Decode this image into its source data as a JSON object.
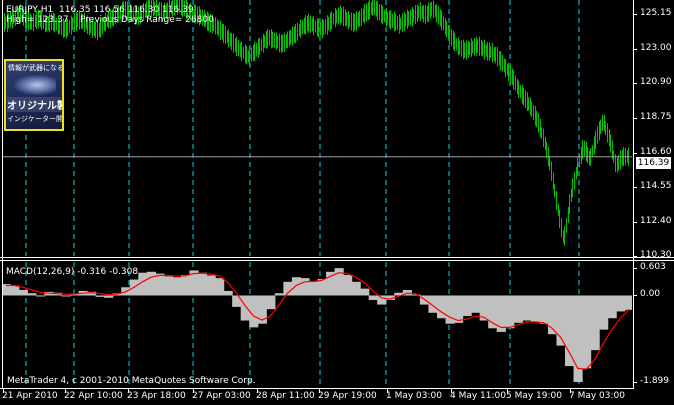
{
  "chart_header": {
    "symbol": "EURJPY,H1",
    "ohlc": "116.35 116.56 116.30 116.39",
    "info_line": "High= 123.37    Previous Days Range= 26800"
  },
  "logo": {
    "line1": "情報が武器になる",
    "line2": "オリジナル製作",
    "line3": "インジケーター開発"
  },
  "current_price": "116.39",
  "macd_header": "MACD(12,26,9) -0.316 -0.308",
  "copyright": "MetaTrader 4, c 2001-2010 MetaQuotes Software Corp.",
  "colors": {
    "background": "#000000",
    "candles": "#00c000",
    "histogram": "#c0c0c0",
    "signal_line": "#ff0000",
    "grid": "#00ffff"
  },
  "chart_data": [
    {
      "type": "line",
      "series": [
        {
          "name": "EURJPY,H1",
          "values": [
            124.6,
            124.9,
            125.2,
            124.8,
            124.6,
            124.9,
            124.5,
            124.7,
            124.4,
            124.2,
            124.5,
            124.8,
            124.6,
            124.3,
            124.1,
            124.6,
            124.9,
            125.1,
            125.4,
            125.2,
            125.0,
            125.3,
            125.6,
            125.4,
            125.2,
            125.5,
            125.7,
            125.5,
            125.3,
            125.1,
            124.9,
            124.6,
            124.4,
            124.0,
            123.6,
            123.2,
            122.8,
            122.5,
            122.9,
            123.3,
            123.7,
            123.5,
            123.3,
            123.6,
            123.9,
            124.3,
            124.6,
            124.4,
            124.2,
            124.5,
            124.9,
            125.1,
            124.8,
            124.6,
            124.9,
            125.3,
            125.6,
            125.2,
            124.9,
            124.7,
            124.5,
            124.8,
            125.0,
            125.3,
            125.1,
            125.5,
            125.0,
            124.3,
            123.6,
            123.1,
            122.9,
            123.1,
            123.2,
            122.9,
            122.8,
            122.5,
            121.9,
            121.4,
            120.6,
            120.0,
            119.4,
            118.6,
            117.4,
            115.8,
            113.4,
            111.2,
            113.8,
            115.6,
            117.0,
            116.2,
            117.6,
            118.6,
            117.4,
            115.8,
            116.4,
            116.39
          ]
        }
      ],
      "y_ticks": [
        "125.15",
        "123.00",
        "120.90",
        "118.75",
        "116.60",
        "114.55",
        "112.40",
        "110.30"
      ],
      "ylim": [
        110.3,
        126.0
      ]
    },
    {
      "type": "bar",
      "series": [
        {
          "name": "MACD",
          "values": [
            0.25,
            0.22,
            0.12,
            0.05,
            0.0,
            0.08,
            0.06,
            -0.02,
            0.04,
            0.1,
            0.08,
            -0.03,
            -0.05,
            0.05,
            0.18,
            0.35,
            0.5,
            0.52,
            0.48,
            0.42,
            0.4,
            0.45,
            0.55,
            0.5,
            0.44,
            0.38,
            0.1,
            -0.25,
            -0.55,
            -0.7,
            -0.62,
            -0.3,
            0.05,
            0.3,
            0.4,
            0.38,
            0.3,
            0.36,
            0.52,
            0.6,
            0.45,
            0.3,
            0.15,
            -0.1,
            -0.2,
            -0.1,
            0.06,
            0.12,
            0.02,
            -0.2,
            -0.38,
            -0.5,
            -0.62,
            -0.6,
            -0.45,
            -0.38,
            -0.55,
            -0.72,
            -0.8,
            -0.72,
            -0.6,
            -0.55,
            -0.58,
            -0.62,
            -0.85,
            -1.1,
            -1.55,
            -1.9,
            -1.6,
            -1.2,
            -0.75,
            -0.5,
            -0.35,
            -0.316
          ]
        },
        {
          "name": "Signal",
          "values": [
            0.22,
            0.22,
            0.18,
            0.12,
            0.07,
            0.05,
            0.04,
            0.03,
            0.03,
            0.05,
            0.06,
            0.04,
            0.02,
            0.03,
            0.08,
            0.18,
            0.3,
            0.4,
            0.44,
            0.44,
            0.42,
            0.43,
            0.48,
            0.49,
            0.47,
            0.43,
            0.28,
            0.05,
            -0.22,
            -0.45,
            -0.54,
            -0.45,
            -0.2,
            0.05,
            0.22,
            0.3,
            0.31,
            0.33,
            0.42,
            0.5,
            0.48,
            0.4,
            0.28,
            0.1,
            -0.05,
            -0.08,
            -0.02,
            0.05,
            0.04,
            -0.08,
            -0.22,
            -0.36,
            -0.48,
            -0.55,
            -0.52,
            -0.45,
            -0.48,
            -0.6,
            -0.7,
            -0.7,
            -0.64,
            -0.58,
            -0.58,
            -0.6,
            -0.72,
            -0.92,
            -1.25,
            -1.6,
            -1.62,
            -1.4,
            -1.05,
            -0.75,
            -0.5,
            -0.308
          ]
        }
      ],
      "y_ticks": [
        "0.603",
        "0.00",
        "-1.899"
      ],
      "ylim": [
        -1.899,
        0.603
      ]
    }
  ],
  "date_labels": [
    "21 Apr 2010",
    "22 Apr 10:00",
    "23 Apr 18:00",
    "27 Apr 03:00",
    "28 Apr 11:00",
    "29 Apr 19:00",
    "1 May 03:00",
    "4 May 11:00",
    "5 May 19:00",
    "7 May 03:00"
  ]
}
